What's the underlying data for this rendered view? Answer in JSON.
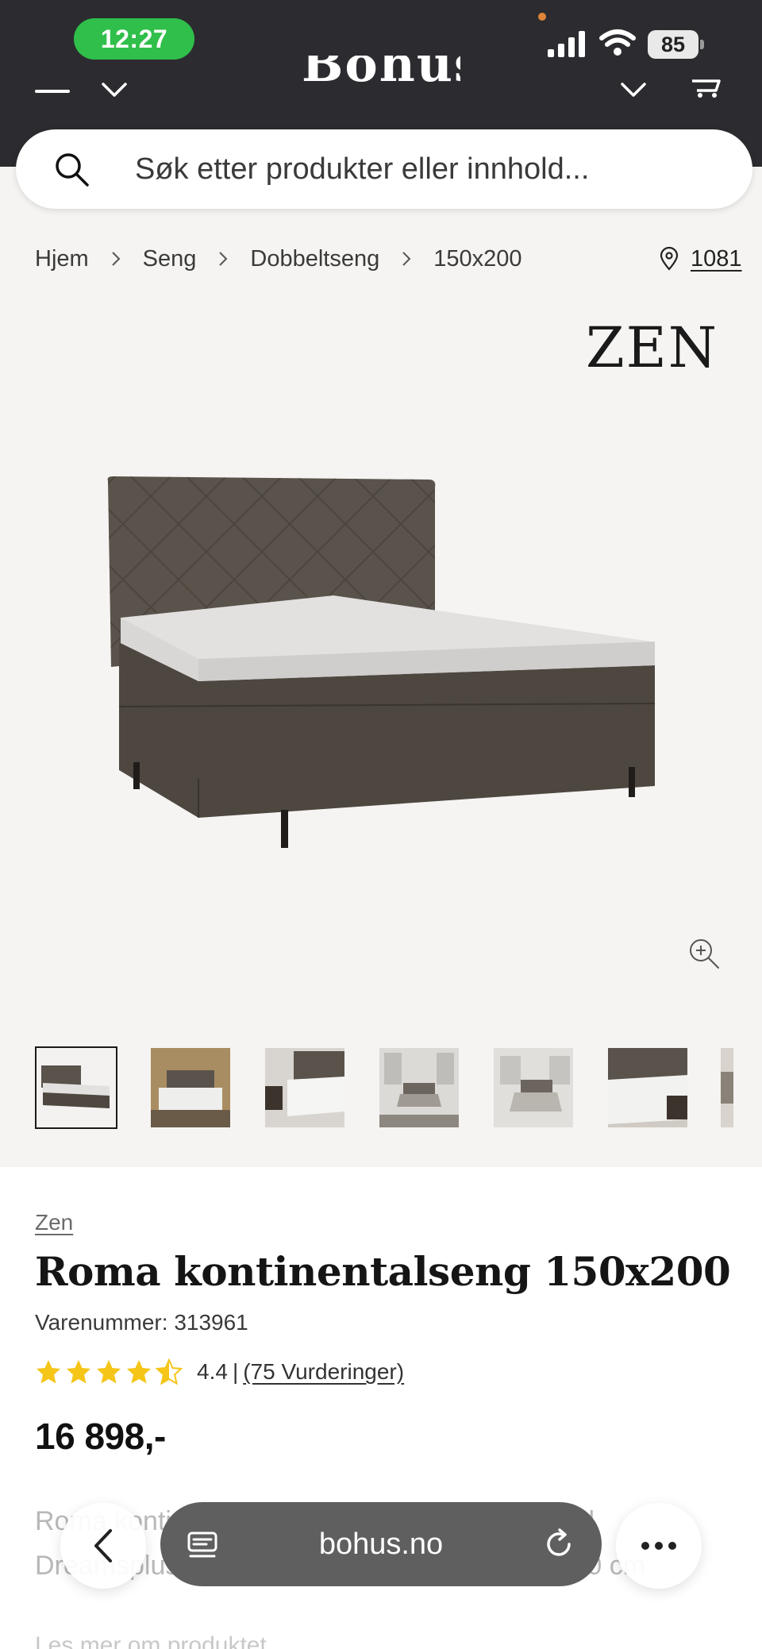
{
  "status_bar": {
    "time": "12:27",
    "battery": "85"
  },
  "header": {
    "logo": "Bohus"
  },
  "search": {
    "placeholder": "Søk etter produkter eller innhold..."
  },
  "breadcrumb": [
    "Hjem",
    "Seng",
    "Dobbeltseng",
    "150x200"
  ],
  "store": {
    "code": "1081"
  },
  "gallery": {
    "brand_logo": "ZEN",
    "thumbnails": [
      "bed-studio",
      "bedroom-warm",
      "bedroom-close",
      "bedroom-loft-1",
      "bedroom-loft-2",
      "bedroom-headboard",
      "bedroom-partial"
    ]
  },
  "product": {
    "brand": "Zen",
    "title": "Roma kontinentalseng 150x200",
    "sku": "Varenummer: 313961",
    "rating": {
      "value": "4.4",
      "separator": "|",
      "reviews": "(75 Vurderinger)",
      "stars": 4.4
    },
    "price": "16 898,-",
    "description": "Roma kontinentalseng er en elegant seng med Dreamsplus madrass og overmadrass 150x200 cm",
    "read_more": "Les mer om produktet"
  },
  "browser": {
    "url": "bohus.no"
  },
  "colors": {
    "header_bg": "#2c2c30",
    "time_pill": "#2fbf4a",
    "star": "#f5c518",
    "page_bg": "#f5f4f2"
  }
}
